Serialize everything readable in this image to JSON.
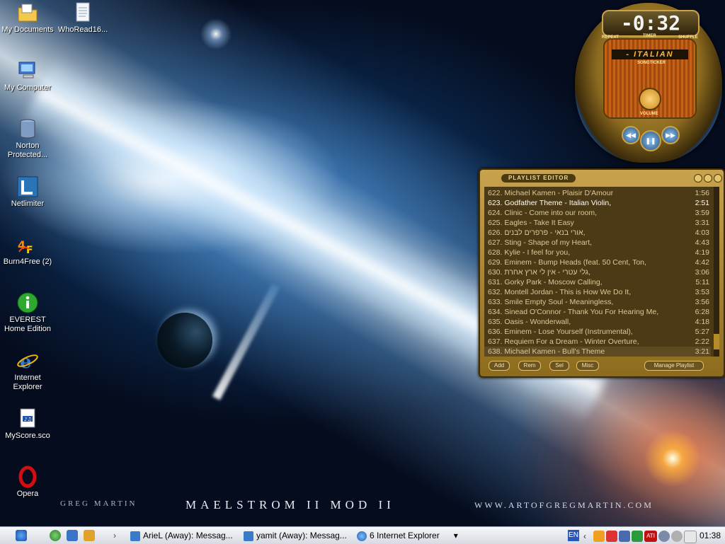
{
  "desktop": {
    "icons": [
      {
        "label": "My Documents",
        "icon": "folder-documents-icon"
      },
      {
        "label": "WhoRead16...",
        "icon": "text-document-icon"
      },
      {
        "label": "My Computer",
        "icon": "computer-icon"
      },
      {
        "label": "Norton Protected...",
        "icon": "norton-bin-icon"
      },
      {
        "label": "Netlimiter",
        "icon": "netlimiter-icon"
      },
      {
        "label": "Burn4Free (2)",
        "icon": "burn4free-icon"
      },
      {
        "label": "EVEREST Home Edition",
        "icon": "everest-info-icon"
      },
      {
        "label": "Internet Explorer",
        "icon": "internet-explorer-icon"
      },
      {
        "label": "MyScore.sco",
        "icon": "score-file-icon"
      },
      {
        "label": "Opera",
        "icon": "opera-icon"
      }
    ],
    "wallpaper": {
      "signature": "GREG MARTIN",
      "title": "MAELSTROM II MOD II",
      "url": "WWW.ARTOFGREGMARTIN.COM"
    }
  },
  "winamp": {
    "time": "-0:32",
    "labels": {
      "repeat": "REPEAT",
      "timer": "TIMER",
      "shuffle": "SHUFFLE",
      "songticker": "SONGTICKER",
      "volume": "VOLUME"
    },
    "songticker_text": "- ITALIAN",
    "playlist": {
      "title": "PLAYLIST EDITOR",
      "items": [
        {
          "text": "622. Michael Kamen - Plaisir D'Amour",
          "duration": "1:56"
        },
        {
          "text": "623. Godfather Theme - Italian Violin,",
          "duration": "2:51",
          "current": true
        },
        {
          "text": "624. Clinic - Come into our room,",
          "duration": "3:59"
        },
        {
          "text": "625. Eagles - Take It Easy",
          "duration": "3:31"
        },
        {
          "text": "626. אורי בנאי - פרפרים לבנים,",
          "duration": "4:03"
        },
        {
          "text": "627. Sting - Shape of my Heart,",
          "duration": "4:43"
        },
        {
          "text": "628. Kylie - I feel for you,",
          "duration": "4:19"
        },
        {
          "text": "629. Eminem - Bump Heads (feat. 50 Cent, Ton,",
          "duration": "4:42"
        },
        {
          "text": "630. גלי עטרי - אין לי ארץ אחרת,",
          "duration": "3:06"
        },
        {
          "text": "631. Gorky Park - Moscow Calling,",
          "duration": "5:11"
        },
        {
          "text": "632. Montell Jordan - This is How We Do It,",
          "duration": "3:53"
        },
        {
          "text": "633. Smile Empty Soul - Meaningless,",
          "duration": "3:56"
        },
        {
          "text": "634. Sinead O'Connor - Thank You For Hearing Me,",
          "duration": "6:28"
        },
        {
          "text": "635. Oasis - Wonderwall,",
          "duration": "4:18"
        },
        {
          "text": "636. Eminem - Lose Yourself (Instrumental),",
          "duration": "5:27"
        },
        {
          "text": "637. Requiem For a Dream - Winter Overture,",
          "duration": "2:22"
        },
        {
          "text": "638. Michael Kamen - Bull's Theme",
          "duration": "3:21",
          "selected": true
        }
      ],
      "buttons": {
        "add": "Add",
        "rem": "Rem",
        "sel": "Sel",
        "misc": "Misc",
        "manage": "Manage Playlist"
      }
    }
  },
  "taskbar": {
    "tasks": [
      {
        "label": "ArieL (Away): Messag..."
      },
      {
        "label": "yamit (Away): Messag..."
      },
      {
        "label": "6 Internet Explorer"
      }
    ],
    "language": "EN",
    "clock": "01:38"
  },
  "colors": {
    "accent_gold": "#c9a24a",
    "playlist_bg": "#4b3a15",
    "playlist_text": "#dcc99a"
  }
}
